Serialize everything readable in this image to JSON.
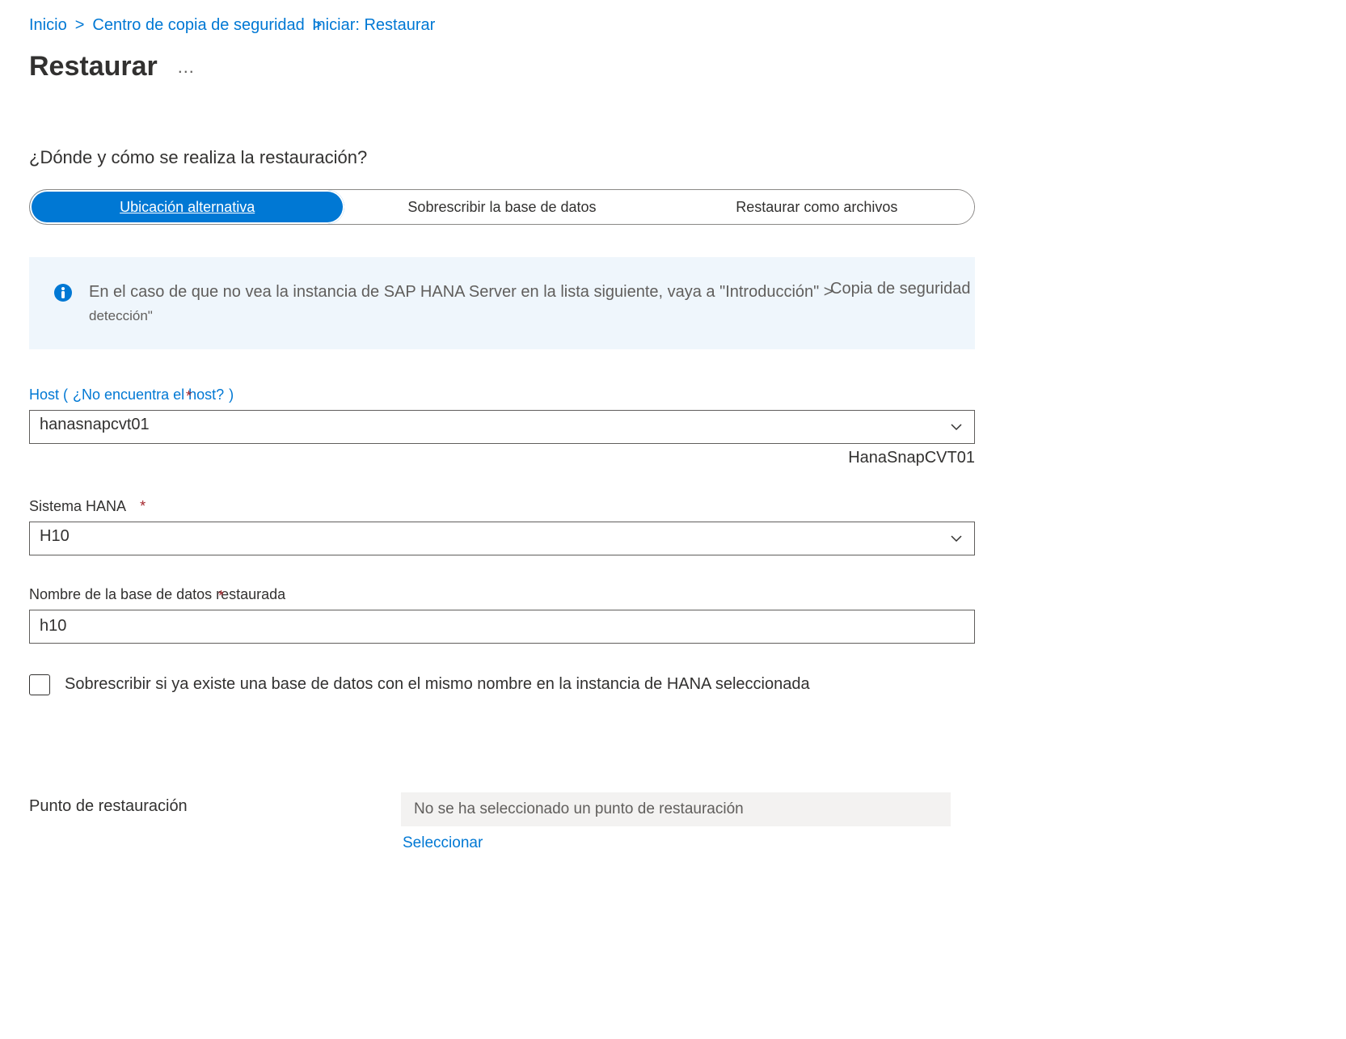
{
  "breadcrumb": {
    "home": "Inicio",
    "sep1": ">",
    "center": "Centro de copia de seguridad",
    "sep2": ">",
    "overlap": "Iniciar: Restaurar"
  },
  "page_title": "Restaurar",
  "ellipsis": "…",
  "section_heading": "¿Dónde y cómo se realiza la restauración?",
  "segmented": {
    "alt_location": "Ubicación alternativa",
    "overwrite_db": "Sobrescribir la base de datos",
    "restore_files": "Restaurar como archivos"
  },
  "info": {
    "line1": "En el caso de que no vea la instancia de SAP HANA Server en la lista siguiente, vaya a \"Introducción\" >",
    "overlap_right": "Copia de seguridad",
    "line2": "detección\""
  },
  "host": {
    "label_prefix": "Host (",
    "link": "¿No encuentra el host?",
    "label_suffix": ")",
    "req_inline_text": "*",
    "value": "hanasnapcvt01",
    "hint": "HanaSnapCVT01"
  },
  "hana_system": {
    "label": "Sistema HANA",
    "value": "H10"
  },
  "db_name": {
    "label": "Nombre de la base de datos restaurada",
    "req_inline_text": "*",
    "value": "h10"
  },
  "overwrite_cb": {
    "label": "Sobrescribir si ya existe una base de datos con el mismo nombre en la instancia de HANA seleccionada"
  },
  "restore_point": {
    "label": "Punto de restauración",
    "readonly": "No se ha seleccionado un punto de restauración",
    "select_link": "Seleccionar"
  },
  "required_marker": "*"
}
